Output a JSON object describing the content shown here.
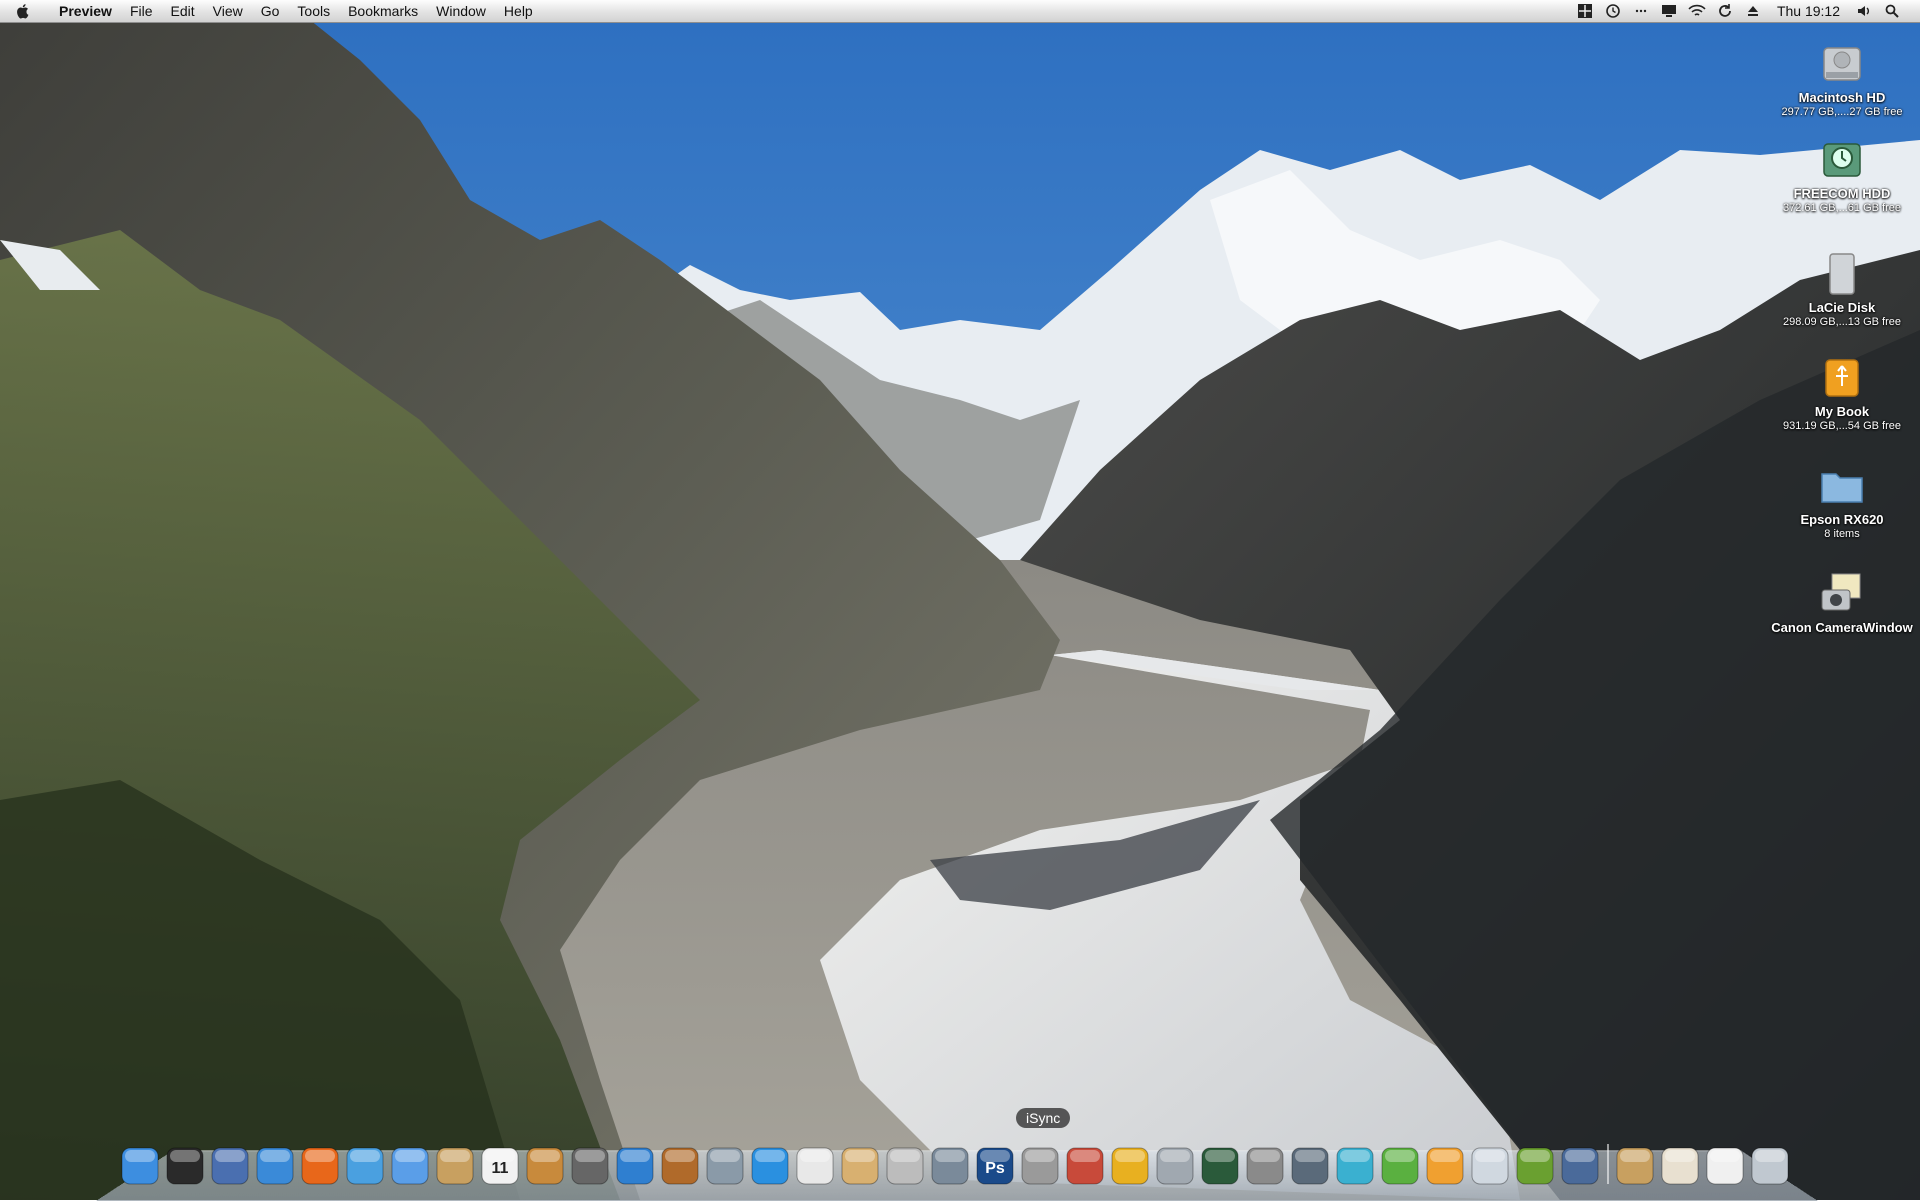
{
  "menubar": {
    "app_name": "Preview",
    "menus": [
      "File",
      "Edit",
      "View",
      "Go",
      "Tools",
      "Bookmarks",
      "Window",
      "Help"
    ],
    "status_icons": [
      "spaces-icon",
      "time-machine-icon",
      "bluetooth-icon",
      "display-icon",
      "wifi-icon",
      "sync-icon",
      "eject-icon"
    ],
    "clock": "Thu 19:12",
    "right_icons": [
      "volume-icon",
      "spotlight-icon"
    ]
  },
  "desktop_icons": [
    {
      "name": "Macintosh HD",
      "info": "297.77 GB,....27 GB free",
      "icon": "hard-drive-icon"
    },
    {
      "name": "FREECOM HDD",
      "info": "372.61 GB,...61 GB free",
      "icon": "time-machine-drive-icon"
    },
    {
      "name": "LaCie Disk",
      "info": "298.09 GB,...13 GB free",
      "icon": "external-drive-icon"
    },
    {
      "name": "My Book",
      "info": "931.19 GB,...54 GB free",
      "icon": "usb-drive-icon"
    },
    {
      "name": "Epson RX620",
      "info": "8 items",
      "icon": "folder-icon"
    },
    {
      "name": "Canon CameraWindow",
      "info": "",
      "icon": "camera-app-icon"
    }
  ],
  "dock": {
    "tooltip": "iSync",
    "apps": [
      {
        "name": "finder",
        "icon": "finder-icon",
        "color": "#3d8ee0"
      },
      {
        "name": "dashboard",
        "icon": "dashboard-icon",
        "color": "#2a2a2a"
      },
      {
        "name": "mail-bird",
        "icon": "eagle-icon",
        "color": "#4a6fb0"
      },
      {
        "name": "safari",
        "icon": "safari-icon",
        "color": "#3a8ad8"
      },
      {
        "name": "firefox",
        "icon": "firefox-icon",
        "color": "#e8671a"
      },
      {
        "name": "itunes",
        "icon": "itunes-icon",
        "color": "#4aa0e0"
      },
      {
        "name": "ichat",
        "icon": "ichat-icon",
        "color": "#5a9ee8"
      },
      {
        "name": "address-book",
        "icon": "address-book-icon",
        "color": "#c8a060"
      },
      {
        "name": "ical",
        "icon": "calendar-icon",
        "color": "#f2f2f2",
        "label": "11"
      },
      {
        "name": "iphoto",
        "icon": "iphoto-icon",
        "color": "#c88a3c"
      },
      {
        "name": "imovie",
        "icon": "imovie-icon",
        "color": "#666666"
      },
      {
        "name": "idvd",
        "icon": "idvd-icon",
        "color": "#2f7fd0"
      },
      {
        "name": "garageband",
        "icon": "guitar-icon",
        "color": "#b06a2a"
      },
      {
        "name": "iweb",
        "icon": "iweb-icon",
        "color": "#8a9aa8"
      },
      {
        "name": "quicktime",
        "icon": "quicktime-icon",
        "color": "#2a90e0"
      },
      {
        "name": "textedit",
        "icon": "textedit-icon",
        "color": "#e8e8e8"
      },
      {
        "name": "installer",
        "icon": "package-icon",
        "color": "#d8b070"
      },
      {
        "name": "dvd-player",
        "icon": "dvd-icon",
        "color": "#bcbcbc"
      },
      {
        "name": "image-capture",
        "icon": "camera-icon",
        "color": "#7a8a9a"
      },
      {
        "name": "photoshop",
        "icon": "photoshop-icon",
        "color": "#1a4a8a",
        "label": "Ps"
      },
      {
        "name": "isync",
        "icon": "isync-icon",
        "color": "#9a9a9a"
      },
      {
        "name": "app-a",
        "icon": "utility-icon",
        "color": "#c84a3a"
      },
      {
        "name": "app-b",
        "icon": "chart-icon",
        "color": "#e8b020"
      },
      {
        "name": "app-c",
        "icon": "stethoscope-icon",
        "color": "#a0a8b0"
      },
      {
        "name": "time-machine",
        "icon": "time-machine-icon",
        "color": "#2a5a3a"
      },
      {
        "name": "system-preferences",
        "icon": "gear-icon",
        "color": "#8a8a8a"
      },
      {
        "name": "app-d",
        "icon": "grid-icon",
        "color": "#5a6a7a"
      },
      {
        "name": "app-e",
        "icon": "w-icon",
        "color": "#3ab0d0"
      },
      {
        "name": "app-f",
        "icon": "x-icon",
        "color": "#5ab040"
      },
      {
        "name": "app-g",
        "icon": "p-icon",
        "color": "#f0a030"
      },
      {
        "name": "app-h",
        "icon": "window-icon",
        "color": "#d0d8e0"
      },
      {
        "name": "app-i",
        "icon": "fruit-icon",
        "color": "#6aa030"
      },
      {
        "name": "preview",
        "icon": "preview-icon",
        "color": "#4a6a9a"
      }
    ],
    "docs": [
      {
        "name": "stack-1",
        "icon": "address-stack-icon",
        "color": "#c8a060"
      },
      {
        "name": "stack-2",
        "icon": "photo-stack-icon",
        "color": "#e8e0d0"
      },
      {
        "name": "stack-3",
        "icon": "document-stack-icon",
        "color": "#f0f0f0"
      },
      {
        "name": "trash",
        "icon": "trash-icon",
        "color": "#c0c8d0"
      }
    ]
  }
}
